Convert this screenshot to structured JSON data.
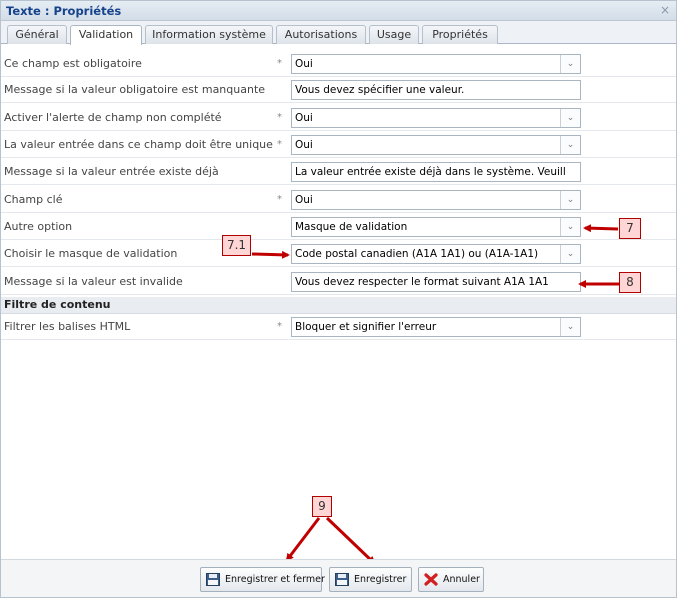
{
  "window": {
    "title": "Texte : Propriétés",
    "close_glyph": "×"
  },
  "tabs": [
    {
      "label": "Général",
      "active": false
    },
    {
      "label": "Validation",
      "active": true
    },
    {
      "label": "Information système",
      "active": false
    },
    {
      "label": "Autorisations",
      "active": false
    },
    {
      "label": "Usage",
      "active": false
    },
    {
      "label": "Propriétés",
      "active": false
    }
  ],
  "fields": [
    {
      "label": "Ce champ est obligatoire",
      "required": true,
      "type": "select",
      "value": "Oui"
    },
    {
      "label": "Message si la valeur obligatoire est manquante",
      "required": false,
      "type": "text",
      "value": "Vous devez spécifier une valeur."
    },
    {
      "label": "Activer l'alerte de champ non complété",
      "required": true,
      "type": "select",
      "value": "Oui"
    },
    {
      "label": "La valeur entrée dans ce champ doit être unique",
      "required": true,
      "type": "select",
      "value": "Oui"
    },
    {
      "label": "Message si la valeur entrée existe déjà",
      "required": false,
      "type": "text",
      "value": "La valeur entrée existe déjà  dans le système. Veuill"
    },
    {
      "label": "Champ clé",
      "required": true,
      "type": "select",
      "value": "Oui"
    },
    {
      "label": "Autre option",
      "required": false,
      "type": "select",
      "value": "Masque de validation"
    },
    {
      "label": "Choisir le masque de validation",
      "required": false,
      "type": "select",
      "value": "Code postal canadien (A1A 1A1) ou (A1A-1A1)"
    },
    {
      "label": "Message si la valeur est invalide",
      "required": false,
      "type": "text",
      "value": "Vous devez respecter le format suivant  A1A 1A1"
    }
  ],
  "section2": {
    "title": "Filtre de contenu",
    "field": {
      "label": "Filtrer les balises HTML",
      "required": true,
      "type": "select",
      "value": "Bloquer et signifier l'erreur"
    }
  },
  "required_marker": "*",
  "dropdown_glyph": "⌄",
  "callouts": {
    "c7": "7",
    "c71": "7.1",
    "c8": "8",
    "c9": "9"
  },
  "annotation_color": "#c00000",
  "buttons": {
    "save_close": "Enregistrer et fermer",
    "save": "Enregistrer",
    "cancel": "Annuler"
  },
  "icons": {
    "save_close": "save-close-icon",
    "save": "floppy-disk-icon",
    "cancel": "red-x-icon"
  }
}
